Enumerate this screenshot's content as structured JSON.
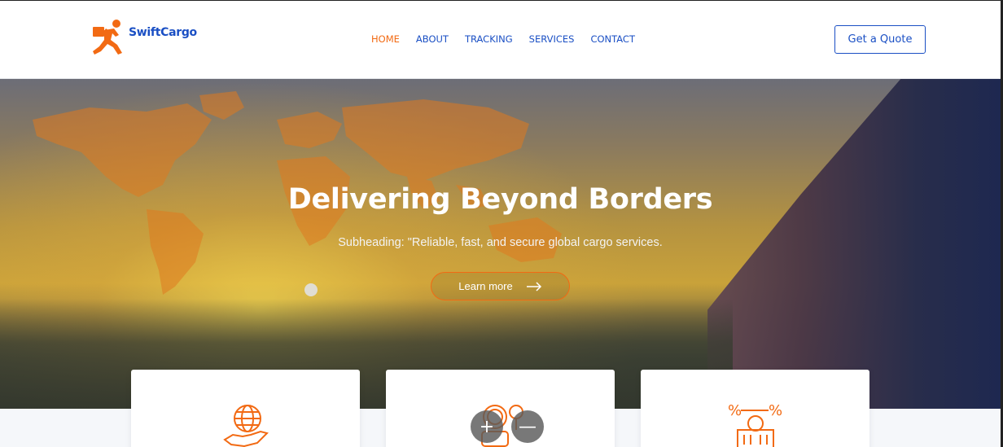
{
  "brand": {
    "name": "SwiftCargo",
    "icon": "running-courier-icon",
    "accent": "#f26a13",
    "primary": "#1a4fc4"
  },
  "nav": {
    "items": [
      {
        "label": "HOME",
        "active": true
      },
      {
        "label": "ABOUT",
        "active": false
      },
      {
        "label": "TRACKING",
        "active": false
      },
      {
        "label": "SERVICES",
        "active": false
      },
      {
        "label": "CONTACT",
        "active": false
      }
    ],
    "cta_label": "Get a Quote"
  },
  "hero": {
    "title": "Delivering Beyond Borders",
    "subtitle": "Subheading: \"Reliable, fast, and secure global cargo services.",
    "button_label": "Learn more",
    "button_icon": "arrow-right-icon"
  },
  "cards": [
    {
      "icon": "globe-hand-icon"
    },
    {
      "icon": "coins-location-icon"
    },
    {
      "icon": "percent-building-icon"
    }
  ],
  "zoom_controls": {
    "zoom_in_label": "+",
    "zoom_out_label": "—"
  }
}
